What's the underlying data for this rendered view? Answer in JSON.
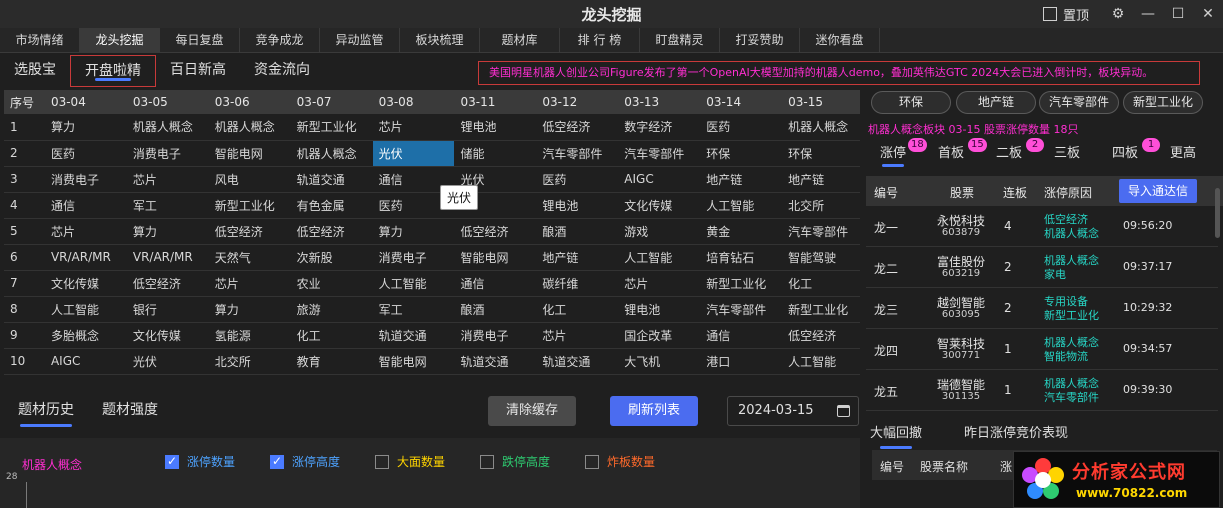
{
  "app": {
    "title": "龙头挖掘",
    "pin_label": "置顶"
  },
  "nav_tabs": [
    "市场情绪",
    "龙头挖掘",
    "每日复盘",
    "竞争成龙",
    "异动监管",
    "板块梳理",
    "题材库",
    "排 行 榜",
    "盯盘精灵",
    "打妥赞助",
    "迷你看盘"
  ],
  "sub_tabs": [
    "选股宝",
    "开盘啦精",
    "百日新高",
    "资金流向"
  ],
  "news": "美国明星机器人创业公司Figure发布了第一个OpenAI大模型加持的机器人demo，叠加英伟达GTC 2024大会已进入倒计时，板块异动。",
  "grid": {
    "headers": [
      "序号",
      "03-04",
      "03-05",
      "03-06",
      "03-07",
      "03-08",
      "03-11",
      "03-12",
      "03-13",
      "03-14",
      "03-15"
    ],
    "rows": [
      [
        "1",
        "算力",
        "机器人概念",
        "机器人概念",
        "新型工业化",
        "芯片",
        "锂电池",
        "低空经济",
        "数字经济",
        "医药",
        "机器人概念"
      ],
      [
        "2",
        "医药",
        "消费电子",
        "智能电网",
        "机器人概念",
        "光伏",
        "储能",
        "汽车零部件",
        "汽车零部件",
        "环保",
        "环保"
      ],
      [
        "3",
        "消费电子",
        "芯片",
        "风电",
        "轨道交通",
        "通信",
        "光伏",
        "医药",
        "AIGC",
        "地产链",
        "地产链"
      ],
      [
        "4",
        "通信",
        "军工",
        "新型工业化",
        "有色金属",
        "医药",
        "",
        "锂电池",
        "文化传媒",
        "人工智能",
        "北交所"
      ],
      [
        "5",
        "芯片",
        "算力",
        "低空经济",
        "低空经济",
        "算力",
        "低空经济",
        "酿酒",
        "游戏",
        "黄金",
        "汽车零部件"
      ],
      [
        "6",
        "VR/AR/MR",
        "VR/AR/MR",
        "天然气",
        "次新股",
        "消费电子",
        "智能电网",
        "地产链",
        "人工智能",
        "培育钻石",
        "智能驾驶"
      ],
      [
        "7",
        "文化传媒",
        "低空经济",
        "芯片",
        "农业",
        "人工智能",
        "通信",
        "碳纤维",
        "芯片",
        "新型工业化",
        "化工"
      ],
      [
        "8",
        "人工智能",
        "银行",
        "算力",
        "旅游",
        "军工",
        "酿酒",
        "化工",
        "锂电池",
        "汽车零部件",
        "新型工业化"
      ],
      [
        "9",
        "多胎概念",
        "文化传媒",
        "氢能源",
        "化工",
        "轨道交通",
        "消费电子",
        "芯片",
        "国企改革",
        "通信",
        "低空经济"
      ],
      [
        "10",
        "AIGC",
        "光伏",
        "北交所",
        "教育",
        "智能电网",
        "轨道交通",
        "轨道交通",
        "大飞机",
        "港口",
        "人工智能"
      ]
    ],
    "tooltip": "光伏"
  },
  "bottom": {
    "tabs": [
      "题材历史",
      "题材强度"
    ],
    "clear_label": "清除缓存",
    "refresh_label": "刷新列表",
    "date": "2024-03-15"
  },
  "chart": {
    "title": "机器人概念",
    "legend": [
      {
        "label": "涨停数量",
        "checked": true,
        "color": "#4ea3ff"
      },
      {
        "label": "涨停高度",
        "checked": true,
        "color": "#4ea3ff"
      },
      {
        "label": "大面数量",
        "checked": false,
        "color": "#ffd400"
      },
      {
        "label": "跌停高度",
        "checked": false,
        "color": "#2ecc71"
      },
      {
        "label": "炸板数量",
        "checked": false,
        "color": "#ff6a2b"
      }
    ],
    "ytick": "28"
  },
  "right": {
    "chips": [
      "环保",
      "地产链",
      "汽车零部件",
      "新型工业化"
    ],
    "concept_line": "机器人概念板块 03-15   股票涨停数量 18只",
    "rank_tabs": [
      {
        "label": "涨停",
        "badge": "18"
      },
      {
        "label": "首板",
        "badge": "15"
      },
      {
        "label": "二板",
        "badge": "2"
      },
      {
        "label": "三板",
        "badge": ""
      },
      {
        "label": "四板",
        "badge": "1"
      },
      {
        "label": "更高",
        "badge": ""
      }
    ],
    "table_headers": [
      "编号",
      "股票",
      "连板",
      "涨停原因"
    ],
    "export_label": "导入通达信",
    "stocks": [
      {
        "rank": "龙一",
        "name": "永悦科技",
        "code": "603879",
        "lianban": "4",
        "reason1": "低空经济",
        "reason2": "机器人概念",
        "time": "09:56:20"
      },
      {
        "rank": "龙二",
        "name": "富佳股份",
        "code": "603219",
        "lianban": "2",
        "reason1": "机器人概念",
        "reason2": "家电",
        "time": "09:37:17"
      },
      {
        "rank": "龙三",
        "name": "越剑智能",
        "code": "603095",
        "lianban": "2",
        "reason1": "专用设备",
        "reason2": "新型工业化",
        "time": "10:29:32"
      },
      {
        "rank": "龙四",
        "name": "智莱科技",
        "code": "300771",
        "lianban": "1",
        "reason1": "机器人概念",
        "reason2": "智能物流",
        "time": "09:34:57"
      },
      {
        "rank": "龙五",
        "name": "瑞德智能",
        "code": "301135",
        "lianban": "1",
        "reason1": "机器人概念",
        "reason2": "汽车零部件",
        "time": "09:39:30"
      }
    ],
    "lower_tabs": [
      "大幅回撤",
      "昨日涨停竞价表现"
    ],
    "lower_headers": [
      "编号",
      "股票名称",
      "涨"
    ]
  },
  "logo": {
    "main": "分析家公式网",
    "url": "www.70822.com"
  }
}
